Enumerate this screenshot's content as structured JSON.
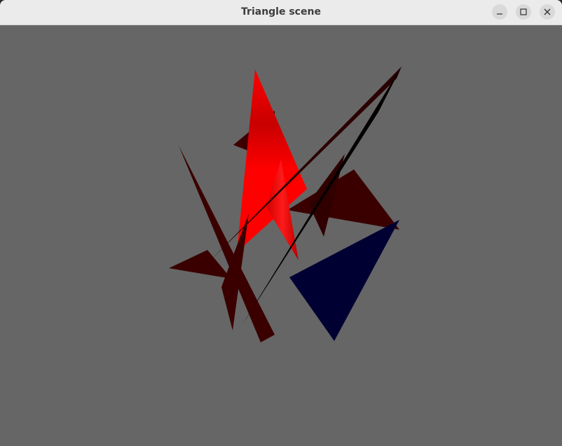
{
  "window": {
    "title": "Triangle scene",
    "buttons": {
      "minimize": "minimize-icon",
      "maximize": "maximize-icon",
      "close": "close-icon"
    }
  },
  "scene": {
    "background": "#666666",
    "colors": {
      "red_bright": "#ff0000",
      "red_dark": "#cc0000",
      "maroon": "#3a0000",
      "dark_maroon": "#2a0000",
      "near_black": "#050000",
      "navy": "#000033"
    }
  }
}
